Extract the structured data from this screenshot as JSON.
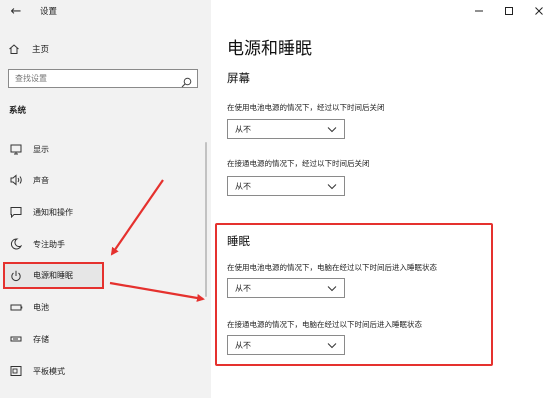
{
  "window": {
    "title": "设置",
    "controls": [
      "minimize",
      "maximize",
      "close"
    ]
  },
  "sidebar": {
    "back_icon": "back-arrow-icon",
    "home_label": "主页",
    "search_placeholder": "查找设置",
    "section_label": "系统",
    "items": [
      {
        "label": "显示",
        "icon": "display-icon"
      },
      {
        "label": "声音",
        "icon": "sound-icon"
      },
      {
        "label": "通知和操作",
        "icon": "notification-icon"
      },
      {
        "label": "专注助手",
        "icon": "moon-icon"
      },
      {
        "label": "电源和睡眠",
        "icon": "power-icon",
        "selected": true
      },
      {
        "label": "电池",
        "icon": "battery-icon"
      },
      {
        "label": "存储",
        "icon": "storage-icon"
      },
      {
        "label": "平板模式",
        "icon": "tablet-icon"
      }
    ]
  },
  "main": {
    "title": "电源和睡眠",
    "screen": {
      "heading": "屏幕",
      "battery_label": "在使用电池电源的情况下，经过以下时间后关闭",
      "battery_value": "从不",
      "plugged_label": "在接通电源的情况下，经过以下时间后关闭",
      "plugged_value": "从不"
    },
    "sleep": {
      "heading": "睡眠",
      "battery_label": "在使用电池电源的情况下，电脑在经过以下时间后进入睡眠状态",
      "battery_value": "从不",
      "plugged_label": "在接通电源的情况下，电脑在经过以下时间后进入睡眠状态",
      "plugged_value": "从不"
    }
  },
  "colors": {
    "annotation_red": "#e5312e",
    "sidebar_bg": "#f2f2f2"
  }
}
